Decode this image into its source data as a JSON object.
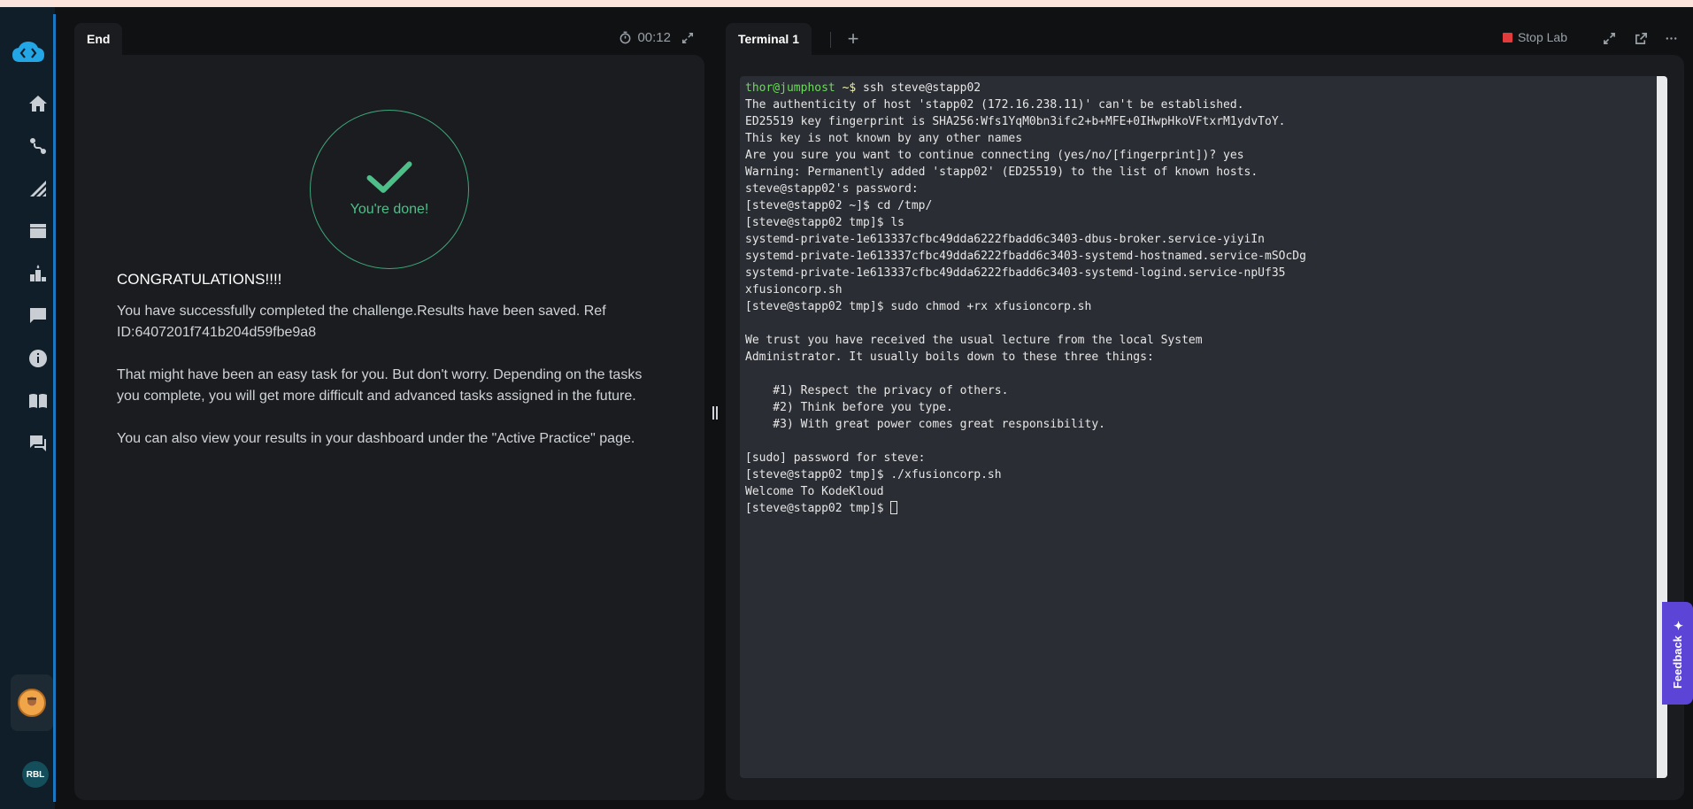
{
  "sidebar": {
    "items": [
      {
        "icon": "home-icon"
      },
      {
        "icon": "route-icon"
      },
      {
        "icon": "climb-icon"
      },
      {
        "icon": "clapperboard-icon"
      },
      {
        "icon": "leaderboard-icon"
      },
      {
        "icon": "feedback-form-icon"
      },
      {
        "icon": "info-icon"
      },
      {
        "icon": "book-icon"
      },
      {
        "icon": "chat-icon"
      }
    ],
    "user_initials": "RBL"
  },
  "left_panel": {
    "tab_label": "End",
    "timer": "00:12",
    "done_label": "You're done!",
    "heading": "CONGRATULATIONS!!!!",
    "paragraphs": [
      "You have successfully completed the challenge.Results have been saved. Ref ID:6407201f741b204d59fbe9a8",
      "That might have been an easy task for you. But don't worry. Depending on the tasks you complete, you will get more difficult and advanced tasks assigned in the future.",
      "You can also view your results in your dashboard under the \"Active Practice\" page."
    ]
  },
  "right_panel": {
    "tab_label": "Terminal 1",
    "add_tab": "+",
    "stop_lab_label": "Stop Lab",
    "terminal": {
      "prompt_user": "thor@jumphost",
      "prompt_path": " ~$",
      "first_command": " ssh steve@stapp02",
      "lines": [
        "The authenticity of host 'stapp02 (172.16.238.11)' can't be established.",
        "ED25519 key fingerprint is SHA256:Wfs1YqM0bn3ifc2+b+MFE+0IHwpHkoVFtxrM1ydvToY.",
        "This key is not known by any other names",
        "Are you sure you want to continue connecting (yes/no/[fingerprint])? yes",
        "Warning: Permanently added 'stapp02' (ED25519) to the list of known hosts.",
        "steve@stapp02's password:",
        "[steve@stapp02 ~]$ cd /tmp/",
        "[steve@stapp02 tmp]$ ls",
        "systemd-private-1e613337cfbc49dda6222fbadd6c3403-dbus-broker.service-yiyiIn",
        "systemd-private-1e613337cfbc49dda6222fbadd6c3403-systemd-hostnamed.service-mSOcDg",
        "systemd-private-1e613337cfbc49dda6222fbadd6c3403-systemd-logind.service-npUf35",
        "xfusioncorp.sh",
        "[steve@stapp02 tmp]$ sudo chmod +rx xfusioncorp.sh",
        "",
        "We trust you have received the usual lecture from the local System",
        "Administrator. It usually boils down to these three things:",
        "",
        "    #1) Respect the privacy of others.",
        "    #2) Think before you type.",
        "    #3) With great power comes great responsibility.",
        "",
        "[sudo] password for steve:",
        "[steve@stapp02 tmp]$ ./xfusioncorp.sh",
        "Welcome To KodeKloud"
      ],
      "last_prompt": "[steve@stapp02 tmp]$ "
    }
  },
  "feedback_label": "Feedback",
  "colors": {
    "accent": "#1a78c2",
    "success": "#4fbf8a",
    "stop": "#e23b3b",
    "feedback": "#5b44d6"
  }
}
